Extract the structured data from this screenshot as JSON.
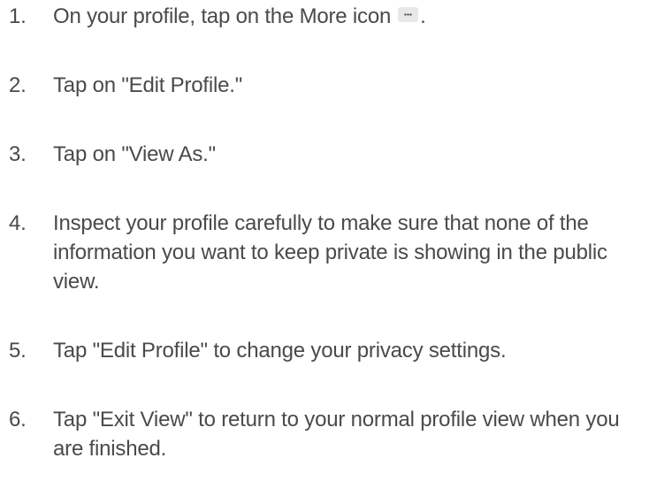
{
  "steps": [
    {
      "number": "1.",
      "before": "On your profile, tap on the More icon",
      "after": ".",
      "icon": "more-icon"
    },
    {
      "number": "2.",
      "text": "Tap on \"Edit Profile.\""
    },
    {
      "number": "3.",
      "text": "Tap on \"View As.\""
    },
    {
      "number": "4.",
      "text": "Inspect your profile carefully to make sure that none of the information you want to keep private is showing in the public view."
    },
    {
      "number": "5.",
      "text": "Tap \"Edit Profile\" to change your privacy settings."
    },
    {
      "number": "6.",
      "text": "Tap \"Exit View\" to return to your normal profile view when you are finished."
    }
  ]
}
